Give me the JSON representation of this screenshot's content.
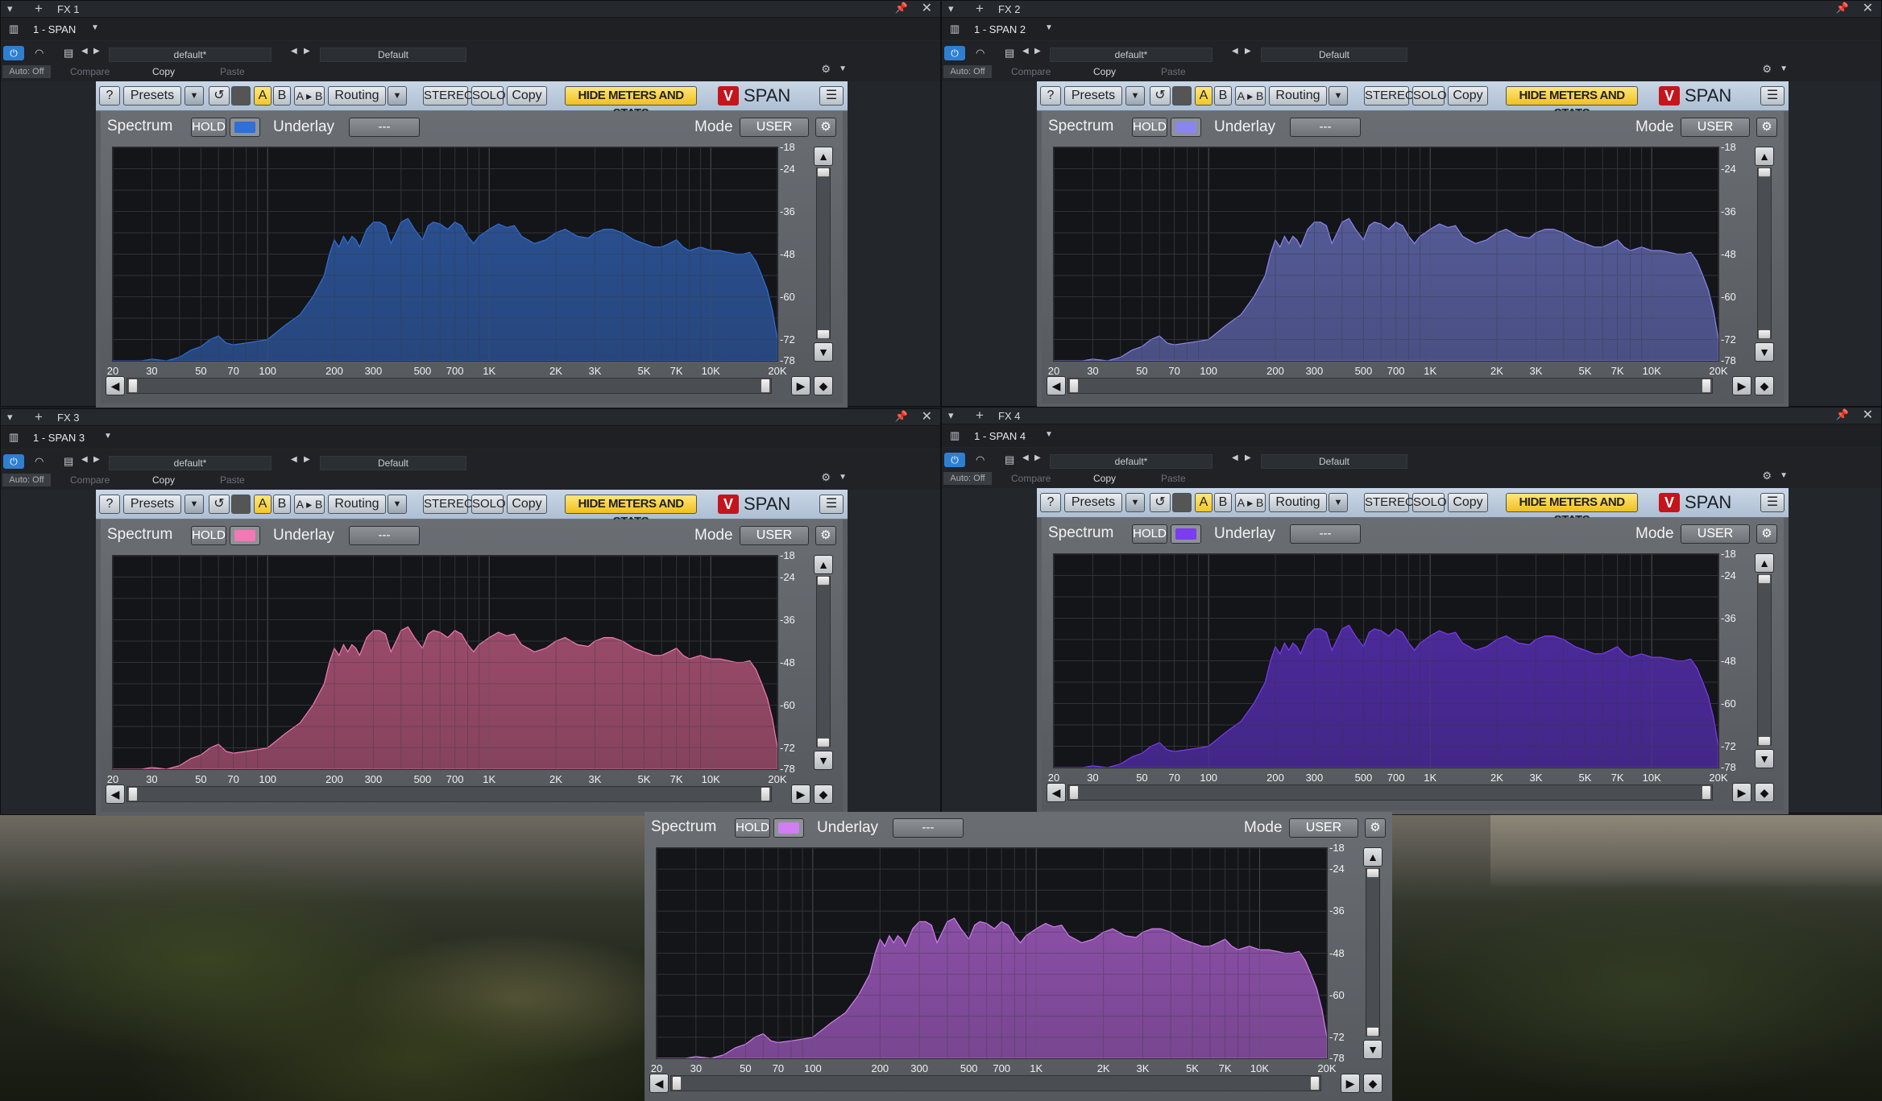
{
  "windows": [
    {
      "id": "w1",
      "title": "FX 1",
      "plugin_instance": "1 - SPAN",
      "color": "#2f6fd8",
      "fill": "#2a4f8f"
    },
    {
      "id": "w2",
      "title": "FX 2",
      "plugin_instance": "1 - SPAN 2",
      "color": "#8a86ee",
      "fill": "#545a96"
    },
    {
      "id": "w3",
      "title": "FX 3",
      "plugin_instance": "1 - SPAN 3",
      "color": "#f07ab4",
      "fill": "#9a4b6a"
    },
    {
      "id": "w4",
      "title": "FX 4",
      "plugin_instance": "1 - SPAN 4",
      "color": "#7c3cf0",
      "fill": "#4b2a9a"
    }
  ],
  "floating": {
    "color": "#d07ef0",
    "fill": "#8a4fa6"
  },
  "host": {
    "preset_left": "default*",
    "preset_right": "Default",
    "auto_off": "Auto: Off",
    "compare": "Compare",
    "copy": "Copy",
    "paste": "Paste"
  },
  "span_toolbar": {
    "help": "?",
    "presets": "Presets",
    "a": "A",
    "b": "B",
    "ab": "A ▸ B",
    "routing": "Routing",
    "stereo": "STEREO",
    "solo": "SOLO",
    "copy": "Copy",
    "hide": "HIDE METERS AND STATS",
    "logo_letter": "V",
    "logo_text": "SPAN"
  },
  "spectrum_panel": {
    "label": "Spectrum",
    "hold": "HOLD",
    "underlay": "Underlay",
    "underlay_value": "---",
    "mode": "Mode",
    "mode_value": "USER"
  },
  "icons": {
    "menu": "hamburger-icon",
    "settings": "gear-icon",
    "undo": "undo-icon",
    "pin": "pin-icon",
    "close": "close-icon"
  },
  "chart_data": {
    "type": "area",
    "xlabel": "",
    "ylabel": "",
    "x_ticks": [
      "20",
      "30",
      "50",
      "70",
      "100",
      "200",
      "300",
      "500",
      "700",
      "1K",
      "2K",
      "3K",
      "5K",
      "7K",
      "10K",
      "20K"
    ],
    "y_ticks": [
      "-18",
      "-24",
      "-36",
      "-48",
      "-60",
      "-72",
      "-78"
    ],
    "ylim": [
      -78,
      -18
    ],
    "xlim": [
      20,
      20000
    ],
    "x_scale": "log",
    "grid": true,
    "x": [
      20,
      27,
      30,
      35,
      40,
      45,
      50,
      55,
      60,
      65,
      70,
      80,
      90,
      100,
      120,
      140,
      160,
      180,
      190,
      200,
      210,
      220,
      230,
      240,
      250,
      260,
      280,
      300,
      320,
      340,
      360,
      380,
      400,
      430,
      460,
      500,
      530,
      560,
      600,
      650,
      700,
      750,
      800,
      850,
      900,
      1000,
      1100,
      1200,
      1300,
      1400,
      1600,
      1800,
      2000,
      2200,
      2500,
      2800,
      3000,
      3300,
      3600,
      4000,
      4500,
      5000,
      5500,
      6000,
      6500,
      7000,
      7500,
      8000,
      9000,
      10000,
      11000,
      12000,
      13000,
      14000,
      15000,
      16000,
      17000,
      18000,
      19000,
      20000
    ],
    "values": [
      -78,
      -78,
      -77.5,
      -78,
      -77,
      -75,
      -74,
      -72,
      -71,
      -73,
      -73.5,
      -73,
      -72.5,
      -72,
      -68,
      -65,
      -60,
      -54,
      -48,
      -44,
      -46,
      -43,
      -45,
      -43,
      -44,
      -46,
      -41,
      -39,
      -39,
      -40,
      -45,
      -42,
      -39,
      -38,
      -41,
      -44,
      -40,
      -39,
      -39.5,
      -41,
      -39,
      -40,
      -43,
      -45,
      -43,
      -41,
      -39.5,
      -40.5,
      -40,
      -43,
      -45,
      -44,
      -42,
      -41,
      -43,
      -43.5,
      -42,
      -41,
      -41,
      -42,
      -44,
      -45,
      -46,
      -46,
      -45,
      -44,
      -46,
      -47,
      -46,
      -47,
      -47,
      -47.5,
      -48,
      -48,
      -47.5,
      -50,
      -54,
      -58,
      -64,
      -72
    ]
  }
}
